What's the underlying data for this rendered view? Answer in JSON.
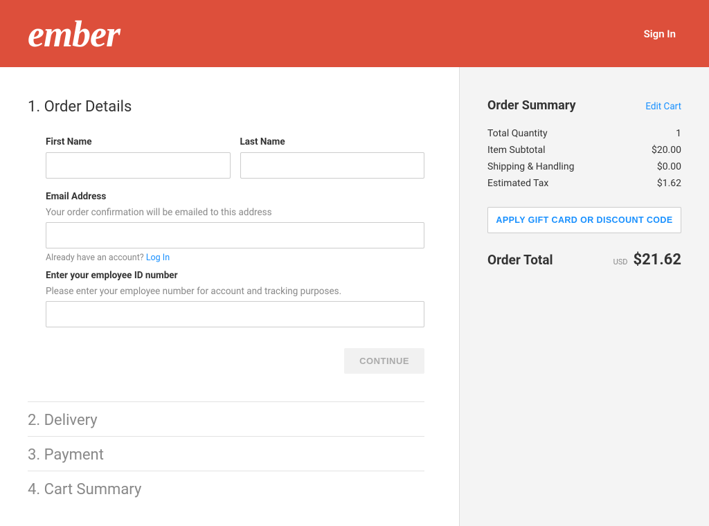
{
  "header": {
    "logo_text": "ember",
    "signin": "Sign In"
  },
  "steps": {
    "s1_title": "1. Order Details",
    "s2_title": "2. Delivery",
    "s3_title": "3. Payment",
    "s4_title": "4. Cart Summary"
  },
  "form": {
    "first_name_label": "First Name",
    "first_name_value": "",
    "last_name_label": "Last Name",
    "last_name_value": "",
    "email_label": "Email Address",
    "email_hint": "Your order confirmation will be emailed to this address",
    "email_value": "",
    "account_note_prefix": "Already have an account? ",
    "account_note_link": "Log In",
    "employee_label": "Enter your employee ID number",
    "employee_hint": "Please enter your employee number for account and tracking purposes.",
    "employee_value": "",
    "continue": "CONTINUE"
  },
  "summary": {
    "title": "Order Summary",
    "edit_cart": "Edit Cart",
    "rows": {
      "qty_label": "Total Quantity",
      "qty_value": "1",
      "subtotal_label": "Item Subtotal",
      "subtotal_value": "$20.00",
      "shipping_label": "Shipping & Handling",
      "shipping_value": "$0.00",
      "tax_label": "Estimated Tax",
      "tax_value": "$1.62"
    },
    "promo_button": "APPLY GIFT CARD OR DISCOUNT CODE",
    "total_label": "Order Total",
    "currency_code": "USD",
    "total_value": "$21.62"
  }
}
